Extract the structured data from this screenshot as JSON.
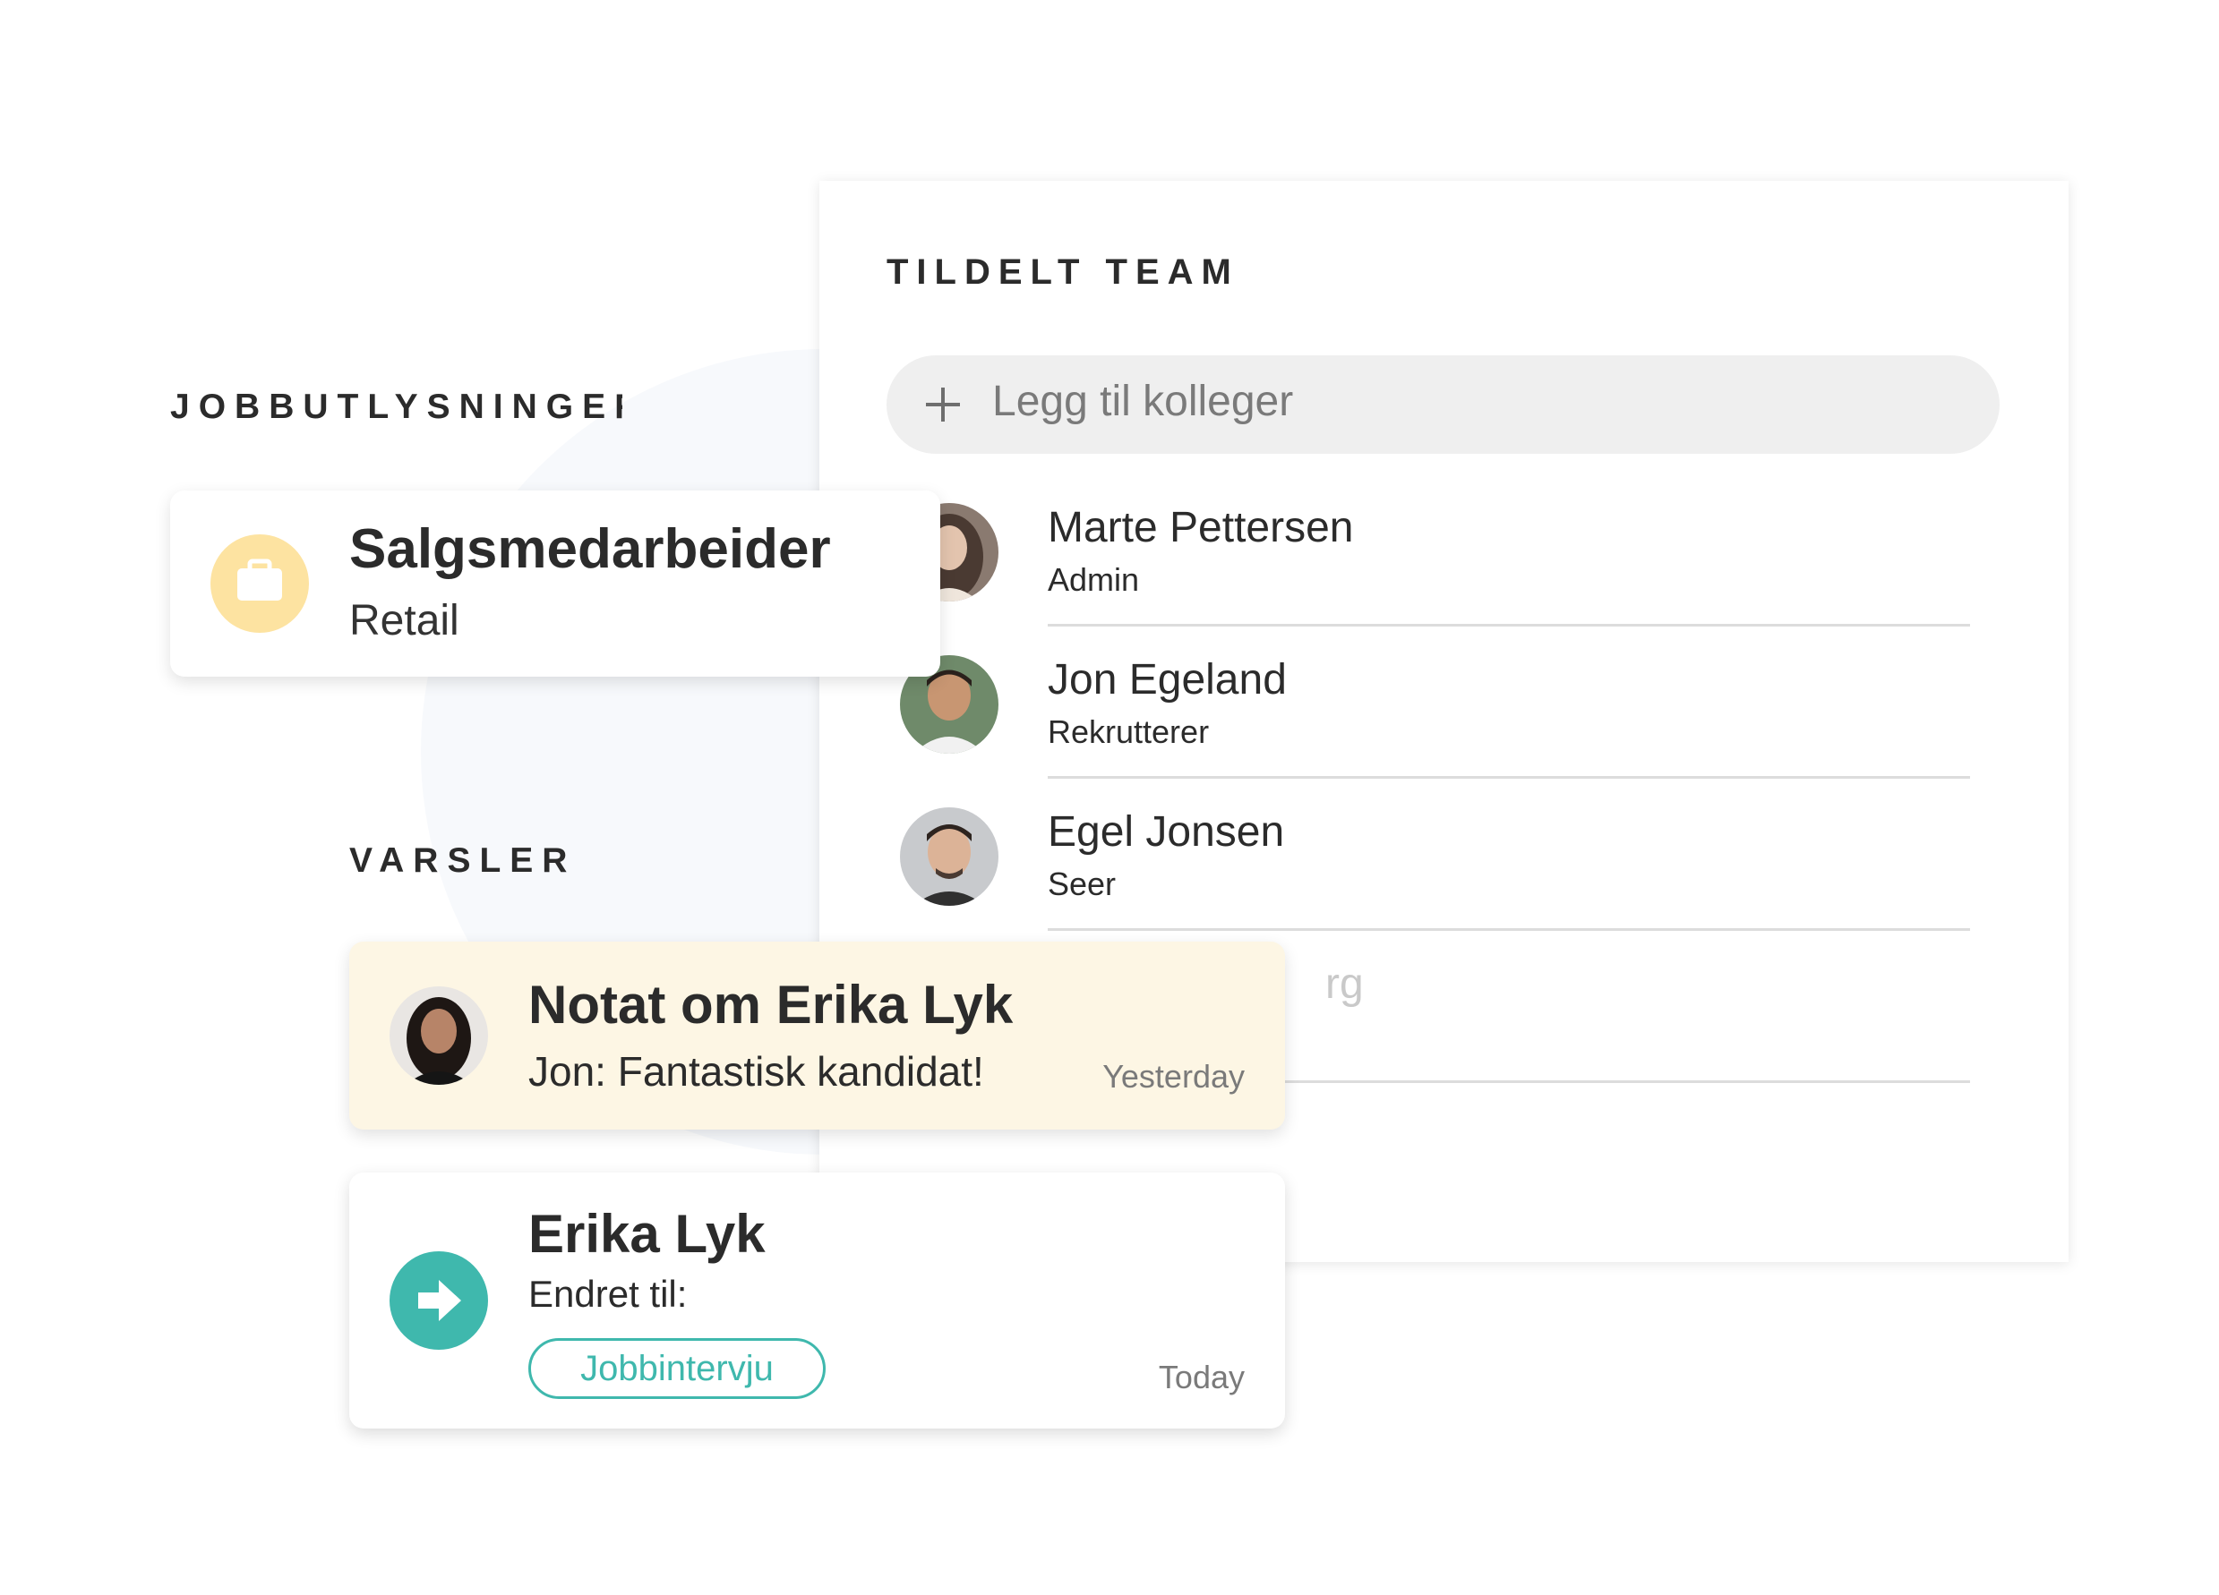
{
  "jobs": {
    "section_label": "JOBBUTLYSNINGER",
    "card": {
      "title": "Salgsmedarbeider",
      "subtitle": "Retail",
      "icon": "briefcase-icon",
      "icon_bg": "#fde3a1"
    }
  },
  "team": {
    "title": "TILDELT TEAM",
    "add_placeholder": "Legg til kolleger",
    "members": [
      {
        "name": "Marte Pettersen",
        "role": "Admin"
      },
      {
        "name": "Jon Egeland",
        "role": "Rekrutterer"
      },
      {
        "name": "Egel Jonsen",
        "role": "Seer"
      },
      {
        "name": "rg",
        "role": ""
      }
    ]
  },
  "alerts": {
    "section_label": "VARSLER",
    "note": {
      "title": "Notat om Erika Lyk",
      "text": "Jon: Fantastisk kandidat!",
      "time": "Yesterday",
      "bg": "#fdf6e4"
    },
    "status": {
      "title": "Erika Lyk",
      "text": "Endret til:",
      "pill": "Jobbintervju",
      "time": "Today",
      "accent": "#3fb8ad",
      "icon": "arrow-right-icon"
    }
  }
}
